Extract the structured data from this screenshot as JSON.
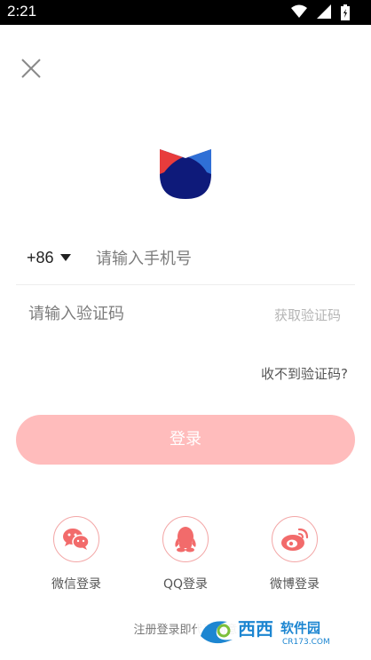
{
  "status_bar": {
    "time": "2:21",
    "icons": [
      "wifi-icon",
      "signal-icon",
      "battery-icon"
    ]
  },
  "colors": {
    "accent": "#f26b6b",
    "login_button": "#ffbcbc",
    "logo_red": "#e83c3c",
    "logo_blue": "#2f6fd6",
    "logo_navy": "#0e1a7a"
  },
  "login": {
    "country_code": "+86",
    "phone_placeholder": "请输入手机号",
    "code_placeholder": "请输入验证码",
    "get_code_label": "获取验证码",
    "no_code_label": "收不到验证码?",
    "login_label": "登录"
  },
  "social": [
    {
      "label": "微信登录",
      "icon": "wechat-icon"
    },
    {
      "label": "QQ登录",
      "icon": "qq-icon"
    },
    {
      "label": "微博登录",
      "icon": "weibo-icon"
    }
  ],
  "agreement": {
    "text": "注册登录即代表同意"
  },
  "watermark": {
    "text": "西西软件园",
    "sub": "CR173.COM"
  }
}
